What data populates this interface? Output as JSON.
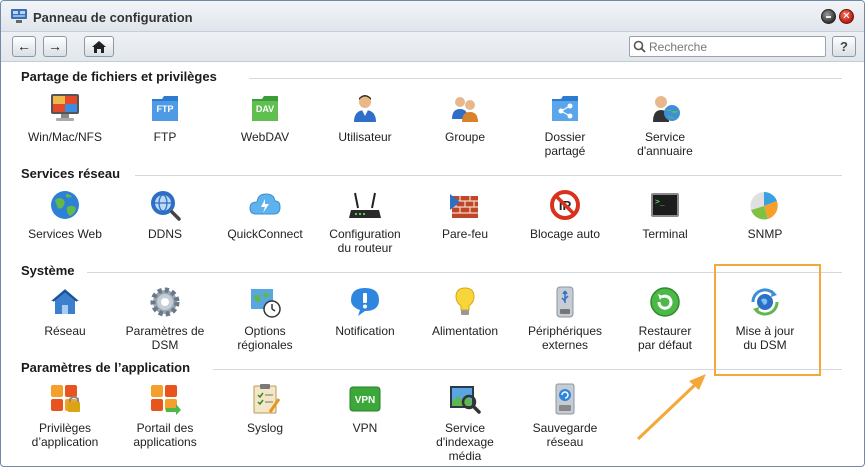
{
  "window": {
    "title": "Panneau de configuration"
  },
  "toolbar": {
    "back": "←",
    "forward": "→",
    "home": "⌂",
    "help": "?"
  },
  "search": {
    "placeholder": "Recherche"
  },
  "sections": [
    {
      "title": "Partage de fichiers et privilèges",
      "items": [
        {
          "label": "Win/Mac/NFS",
          "icon": "win-mac-nfs-icon"
        },
        {
          "label": "FTP",
          "icon": "ftp-icon"
        },
        {
          "label": "WebDAV",
          "icon": "webdav-icon"
        },
        {
          "label": "Utilisateur",
          "icon": "user-icon"
        },
        {
          "label": "Groupe",
          "icon": "group-icon"
        },
        {
          "label": "Dossier\npartagé",
          "icon": "shared-folder-icon"
        },
        {
          "label": "Service\nd'annuaire",
          "icon": "directory-service-icon"
        }
      ]
    },
    {
      "title": "Services réseau",
      "items": [
        {
          "label": "Services Web",
          "icon": "web-services-icon"
        },
        {
          "label": "DDNS",
          "icon": "ddns-icon"
        },
        {
          "label": "QuickConnect",
          "icon": "quickconnect-icon"
        },
        {
          "label": "Configuration\ndu routeur",
          "icon": "router-icon"
        },
        {
          "label": "Pare-feu",
          "icon": "firewall-icon"
        },
        {
          "label": "Blocage auto",
          "icon": "auto-block-icon"
        },
        {
          "label": "Terminal",
          "icon": "terminal-icon"
        },
        {
          "label": "SNMP",
          "icon": "snmp-icon"
        }
      ]
    },
    {
      "title": "Système",
      "items": [
        {
          "label": "Réseau",
          "icon": "network-icon"
        },
        {
          "label": "Paramètres de\nDSM",
          "icon": "dsm-settings-icon"
        },
        {
          "label": "Options\nrégionales",
          "icon": "regional-options-icon"
        },
        {
          "label": "Notification",
          "icon": "notification-icon"
        },
        {
          "label": "Alimentation",
          "icon": "power-icon"
        },
        {
          "label": "Périphériques\nexternes",
          "icon": "external-devices-icon"
        },
        {
          "label": "Restaurer\npar défaut",
          "icon": "restore-icon"
        },
        {
          "label": "Mise à jour\ndu DSM",
          "icon": "dsm-update-icon"
        }
      ]
    },
    {
      "title": "Paramètres de l’application",
      "items": [
        {
          "label": "Privilèges\nd’application",
          "icon": "app-privileges-icon"
        },
        {
          "label": "Portail des\napplications",
          "icon": "app-portal-icon"
        },
        {
          "label": "Syslog",
          "icon": "syslog-icon"
        },
        {
          "label": "VPN",
          "icon": "vpn-icon"
        },
        {
          "label": "Service\nd'indexage\nmédia",
          "icon": "media-indexing-icon"
        },
        {
          "label": "Sauvegarde\nréseau",
          "icon": "network-backup-icon"
        }
      ]
    }
  ],
  "badges": {
    "ftp": "FTP",
    "webdav": "DAV",
    "vpn": "VPN"
  },
  "colors": {
    "highlight": "#f4a83a",
    "accent_blue": "#3b7fd0"
  }
}
